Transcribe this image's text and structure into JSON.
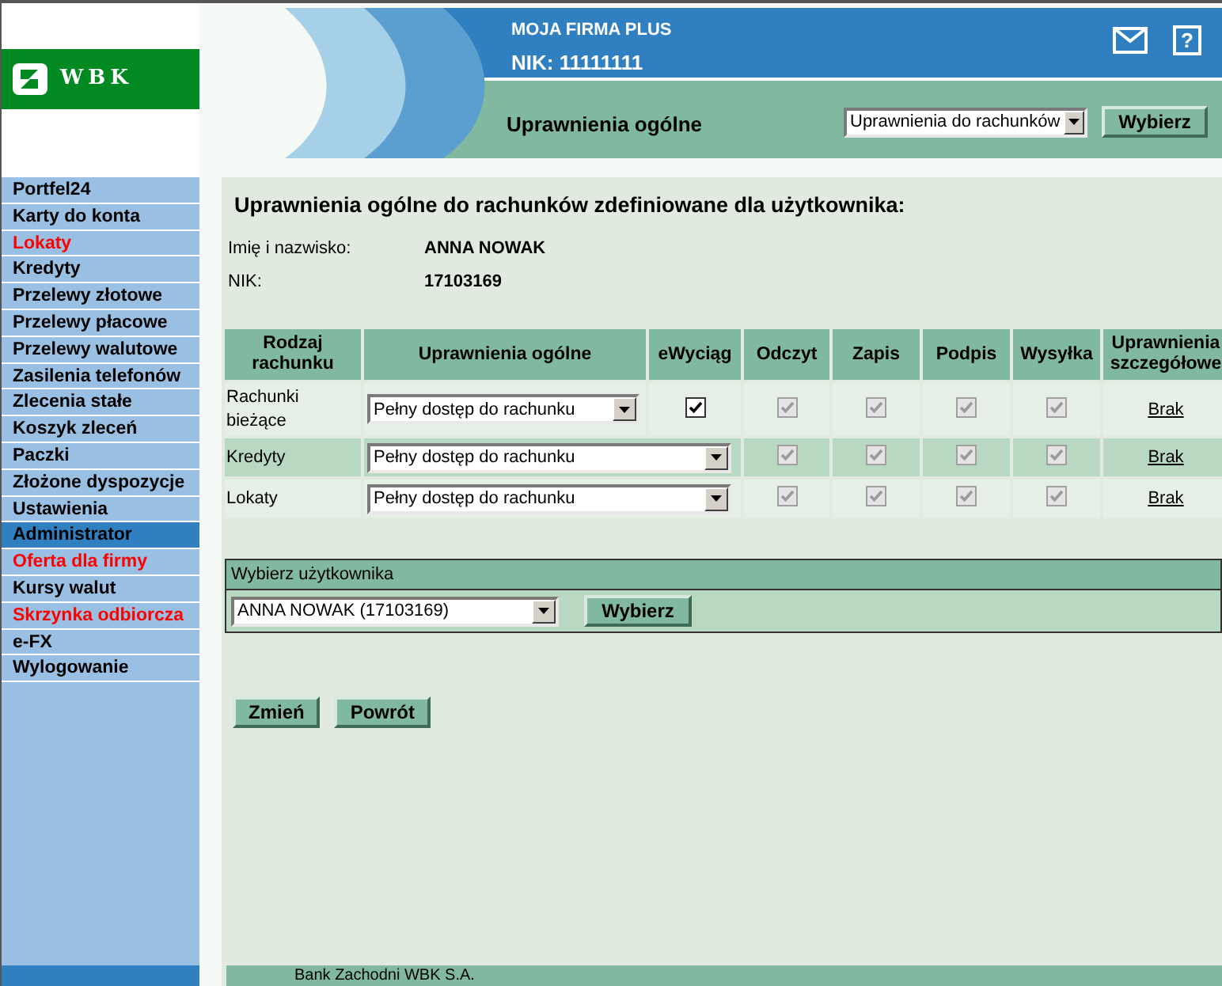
{
  "logo": {
    "text": "WBK"
  },
  "header": {
    "company": "MOJA FIRMA PLUS",
    "nik": "NIK: 11111111",
    "page_title": "Uprawnienia ogólne",
    "view_select": {
      "value": "Uprawnienia do rachunków"
    },
    "view_button": "Wybierz",
    "help": "?"
  },
  "sidebar": {
    "items": [
      {
        "label": "Portfel24",
        "selected": false,
        "highlighted": false
      },
      {
        "label": "Karty do konta",
        "selected": false,
        "highlighted": false
      },
      {
        "label": "Lokaty",
        "selected": false,
        "highlighted": true
      },
      {
        "label": "Kredyty",
        "selected": false,
        "highlighted": false
      },
      {
        "label": "Przelewy złotowe",
        "selected": false,
        "highlighted": false
      },
      {
        "label": "Przelewy płacowe",
        "selected": false,
        "highlighted": false
      },
      {
        "label": "Przelewy walutowe",
        "selected": false,
        "highlighted": false
      },
      {
        "label": "Zasilenia telefonów",
        "selected": false,
        "highlighted": false
      },
      {
        "label": "Zlecenia stałe",
        "selected": false,
        "highlighted": false
      },
      {
        "label": "Koszyk zleceń",
        "selected": false,
        "highlighted": false
      },
      {
        "label": "Paczki",
        "selected": false,
        "highlighted": false
      },
      {
        "label": "Złożone dyspozycje",
        "selected": false,
        "highlighted": false
      },
      {
        "label": "Ustawienia",
        "selected": false,
        "highlighted": false
      },
      {
        "label": "Administrator",
        "selected": true,
        "highlighted": false
      },
      {
        "label": "Oferta dla firmy",
        "selected": false,
        "highlighted": true
      },
      {
        "label": "Kursy walut",
        "selected": false,
        "highlighted": false
      },
      {
        "label": "Skrzynka odbiorcza",
        "selected": false,
        "highlighted": true
      },
      {
        "label": "e-FX",
        "selected": false,
        "highlighted": false
      },
      {
        "label": "Wylogowanie",
        "selected": false,
        "highlighted": false
      }
    ]
  },
  "summary": {
    "heading": "Uprawnienia ogólne do rachunków zdefiniowane dla użytkownika:",
    "fields": [
      {
        "label": "Imię i nazwisko:",
        "value": "ANNA NOWAK"
      },
      {
        "label": "NIK:",
        "value": "17103169"
      }
    ]
  },
  "table": {
    "columns": [
      "Rodzaj rachunku",
      "Uprawnienia ogólne",
      "eWyciąg",
      "Odczyt",
      "Zapis",
      "Podpis",
      "Wysyłka",
      "Uprawnienia szczegółowe"
    ],
    "rows": [
      {
        "type": "Rachunki bieżące",
        "access": "Pełny dostęp do rachunku",
        "ewyciag": {
          "checked": true,
          "disabled": false
        },
        "permissions": [
          {
            "checked": true,
            "disabled": true
          },
          {
            "checked": true,
            "disabled": true
          },
          {
            "checked": true,
            "disabled": true
          },
          {
            "checked": true,
            "disabled": true
          }
        ],
        "details": "Brak"
      },
      {
        "type": "Kredyty",
        "access": "Pełny dostęp do rachunku",
        "permissions": [
          {
            "checked": true,
            "disabled": true
          },
          {
            "checked": true,
            "disabled": true
          },
          {
            "checked": true,
            "disabled": true
          },
          {
            "checked": true,
            "disabled": true
          }
        ],
        "details": "Brak"
      },
      {
        "type": "Lokaty",
        "access": "Pełny dostęp do rachunku",
        "permissions": [
          {
            "checked": true,
            "disabled": true
          },
          {
            "checked": true,
            "disabled": true
          },
          {
            "checked": true,
            "disabled": true
          },
          {
            "checked": true,
            "disabled": true
          }
        ],
        "details": "Brak"
      }
    ]
  },
  "user_picker": {
    "title": "Wybierz użytkownika",
    "select": {
      "value": "ANNA NOWAK (17103169)"
    },
    "button": "Wybierz"
  },
  "actions": [
    "Zmień",
    "Powrót"
  ],
  "footer": {
    "text": "Bank Zachodni WBK S.A."
  }
}
